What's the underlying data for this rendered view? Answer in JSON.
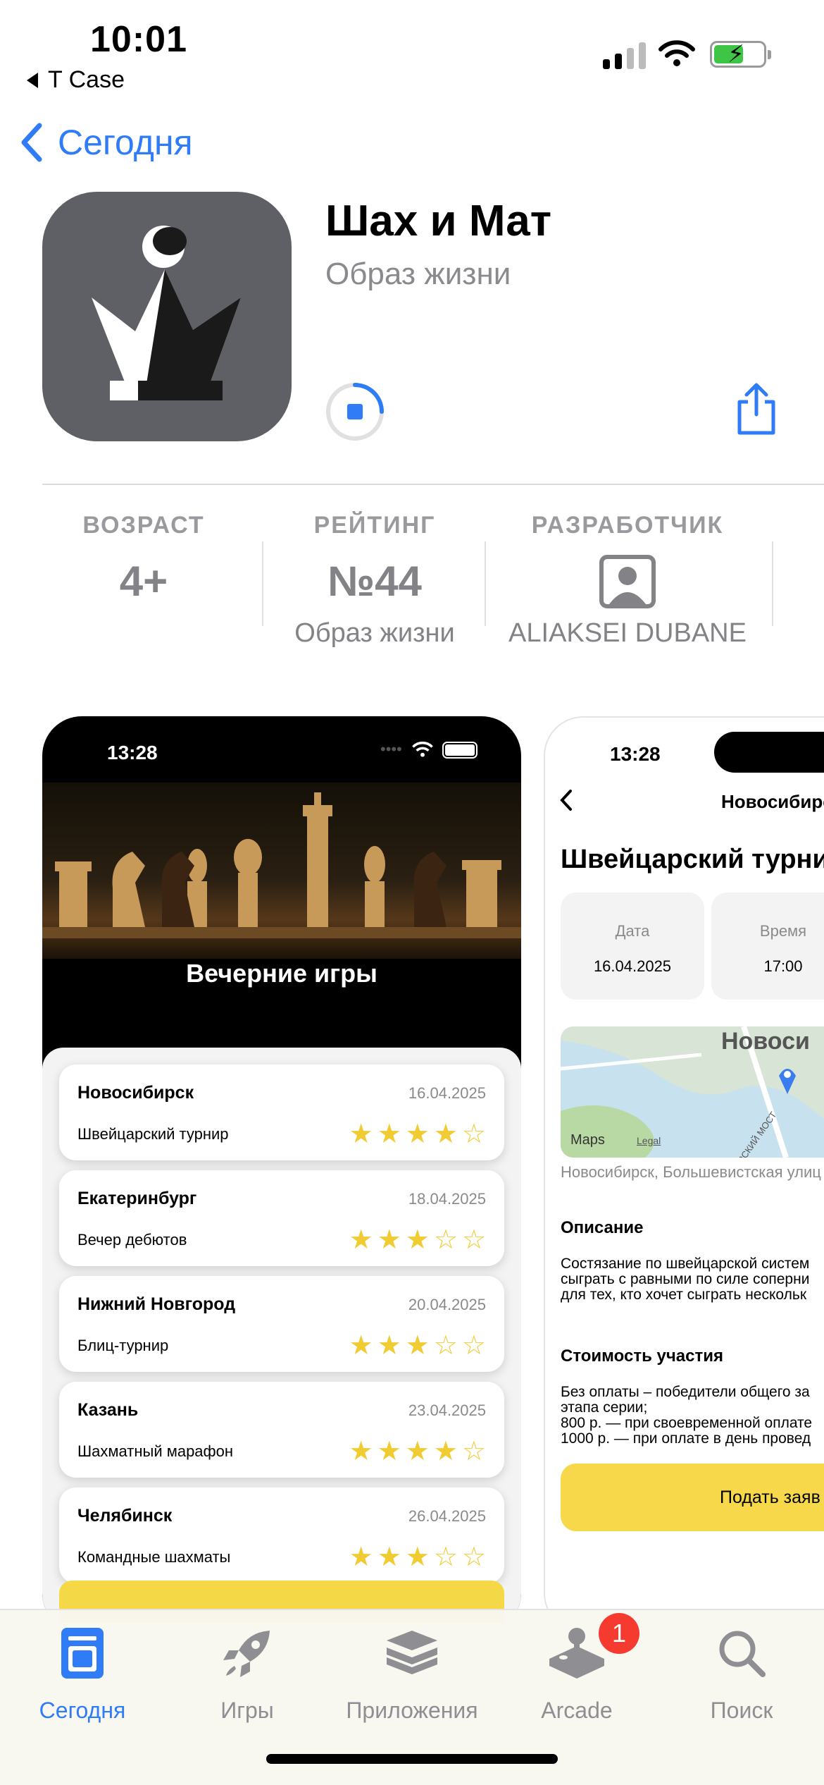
{
  "status_bar": {
    "time": "10:01",
    "back_app": "T Case"
  },
  "nav": {
    "back_label": "Сегодня"
  },
  "app": {
    "title": "Шах и Мат",
    "category": "Образ жизни"
  },
  "info": [
    {
      "label": "ВОЗРАСТ",
      "value": "4+",
      "sub": ""
    },
    {
      "label": "РЕЙТИНГ",
      "value": "№44",
      "sub": "Образ жизни"
    },
    {
      "label": "РАЗРАБОТЧИК",
      "value": "",
      "sub": "ALIAKSEI DUBANE"
    }
  ],
  "screenshot1": {
    "time": "13:28",
    "heading": "Вечерние игры",
    "events": [
      {
        "city": "Новосибирск",
        "date": "16.04.2025",
        "type": "Швейцарский турнир",
        "stars": "★★★★☆",
        "rating": 4
      },
      {
        "city": "Екатеринбург",
        "date": "18.04.2025",
        "type": "Вечер дебютов",
        "stars": "★★★☆☆",
        "rating": 3
      },
      {
        "city": "Нижний Новгород",
        "date": "20.04.2025",
        "type": "Блиц-турнир",
        "stars": "★★★☆☆",
        "rating": 3
      },
      {
        "city": "Казань",
        "date": "23.04.2025",
        "type": "Шахматный марафон",
        "stars": "★★★★☆",
        "rating": 4
      },
      {
        "city": "Челябинск",
        "date": "26.04.2025",
        "type": "Командные шахматы",
        "stars": "★★★☆☆",
        "rating": 3
      }
    ]
  },
  "screenshot2": {
    "time": "13:28",
    "nav_title": "Новосибирс",
    "title": "Швейцарский турнир",
    "date_label": "Дата",
    "date_value": "16.04.2025",
    "time_label": "Время",
    "time_value": "17:00",
    "map_city": "Новоси",
    "map_brand": "Maps",
    "map_legal": "Legal",
    "map_street": "РСКИЙ МОСТ",
    "address": "Новосибирск, Большевистская улиц",
    "desc_heading": "Описание",
    "desc_lines": [
      "Состязание по швейцарской систем",
      "сыграть с равными по силе соперни",
      "для тех, кто хочет сыграть нескольк"
    ],
    "cost_heading": "Стоимость участия",
    "cost_lines": [
      "Без оплаты – победители общего за",
      "этапа серии;",
      "800 р. — при своевременной оплате",
      "1000 р. — при оплате в день провед"
    ],
    "button": "Подать заяв"
  },
  "tabs": [
    {
      "label": "Сегодня",
      "icon": "today-icon",
      "active": true
    },
    {
      "label": "Игры",
      "icon": "rocket-icon",
      "active": false
    },
    {
      "label": "Приложения",
      "icon": "layers-icon",
      "active": false
    },
    {
      "label": "Arcade",
      "icon": "joystick-icon",
      "active": false
    },
    {
      "label": "Поиск",
      "icon": "search-icon",
      "active": false
    }
  ],
  "badge": "1",
  "colors": {
    "accent": "#2f7cf6",
    "star": "#f0cc32",
    "button": "#f6d84a",
    "badge": "#f53b30"
  }
}
